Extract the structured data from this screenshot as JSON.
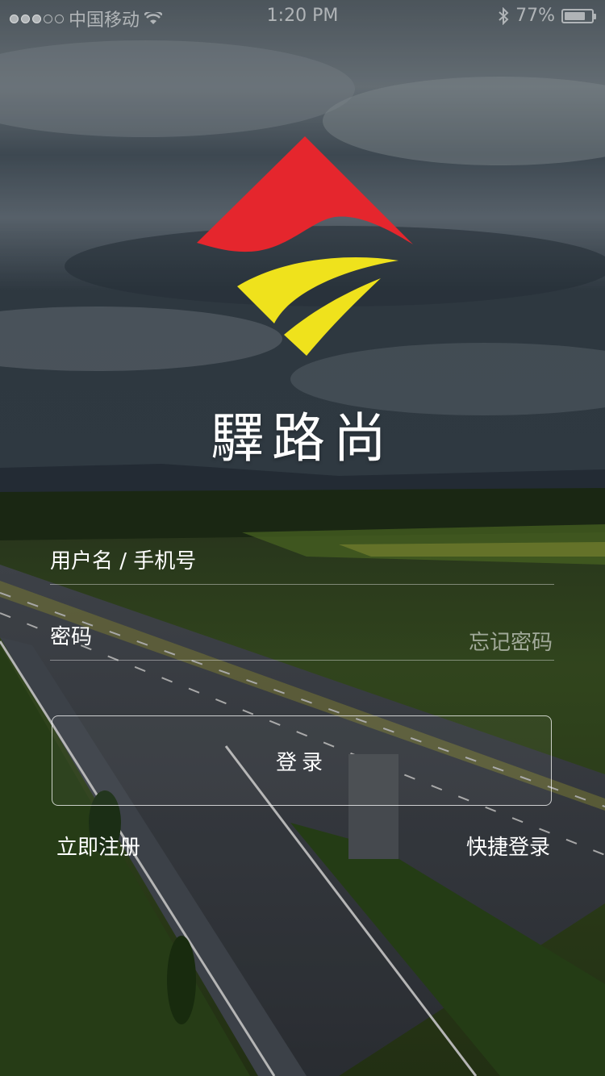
{
  "status_bar": {
    "carrier": "中国移动",
    "time": "1:20 PM",
    "battery": "77%",
    "battery_level": 0.77,
    "signal_bars": 3,
    "icons": [
      "signal-dots-icon",
      "wifi-icon",
      "bluetooth-icon",
      "battery-icon"
    ]
  },
  "brand": {
    "name": "驛路尚",
    "logo_colors": {
      "roof": "#E5262D",
      "road": "#EFE21C"
    }
  },
  "form": {
    "username_placeholder": "用户名 / 手机号",
    "password_placeholder": "密码",
    "forgot_password": "忘记密码",
    "login_button": "登录",
    "register_link": "立即注册",
    "quick_login_link": "快捷登录"
  }
}
